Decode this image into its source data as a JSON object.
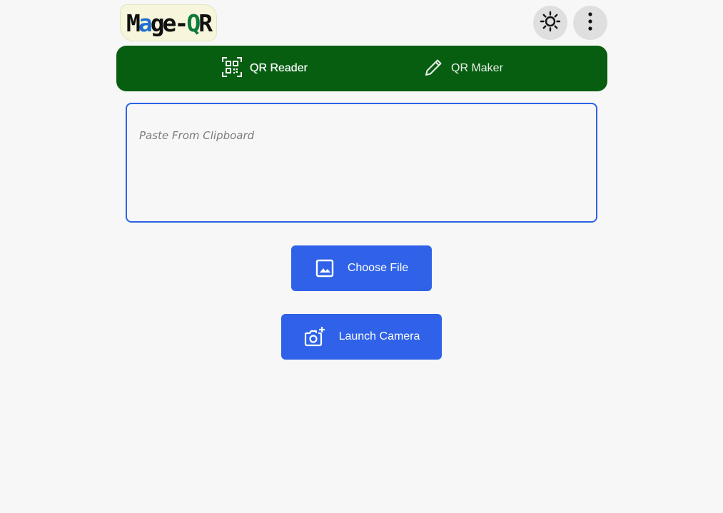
{
  "header": {
    "logo": {
      "parts": [
        "M",
        "a",
        "ge",
        "-",
        "Q",
        "R"
      ],
      "alt": "Mage-QR"
    },
    "theme_icon": "sun-icon",
    "menu_icon": "more-vert-icon"
  },
  "tabs": [
    {
      "label": "QR Reader",
      "icon": "qr-scan-icon",
      "active": true
    },
    {
      "label": "QR Maker",
      "icon": "pencil-icon",
      "active": false
    }
  ],
  "reader": {
    "paste": {
      "placeholder": "Paste From Clipboard",
      "value": ""
    },
    "choose_file": {
      "label": "Choose File",
      "icon": "image-icon"
    },
    "launch_camera": {
      "label": "Launch Camera",
      "icon": "add-camera-icon"
    }
  },
  "colors": {
    "background": "#f6f7f6",
    "tabbar": "#075e11",
    "accent": "#2f62e8",
    "icon_button_bg": "#dedfde"
  }
}
